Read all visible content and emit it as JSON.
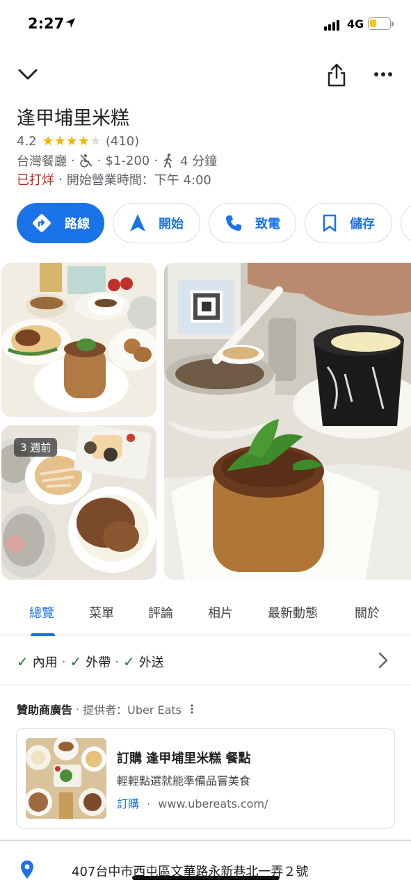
{
  "status_bar": {
    "time": "2:27",
    "network": "4G"
  },
  "place": {
    "name": "逢甲埔里米糕",
    "rating": "4.2",
    "stars_value": 4.2,
    "review_count": "(410)",
    "category": "台灣餐廳",
    "price": "$1-200",
    "walk_time": "4 分鐘",
    "status": "已打烊",
    "opens": "開始營業時間：下午 4:00",
    "address": "407台中市西屯區文華路永新巷北一弄２號"
  },
  "actions": [
    {
      "label": "路線",
      "icon": "directions-icon"
    },
    {
      "label": "開始",
      "icon": "navigation-arrow-icon"
    },
    {
      "label": "致電",
      "icon": "phone-icon"
    },
    {
      "label": "儲存",
      "icon": "bookmark-icon"
    }
  ],
  "photos": {
    "badge": "3 週前"
  },
  "tabs": [
    "總覽",
    "菜單",
    "評論",
    "相片",
    "最新動態",
    "關於"
  ],
  "active_tab": "總覽",
  "services": [
    "內用",
    "外帶",
    "外送"
  ],
  "ad": {
    "header_label": "贊助商廣告",
    "provider": "提供者：Uber Eats",
    "title": "訂購 逢甲埔里米糕 餐點",
    "description": "輕輕點選就能準備品嘗美食",
    "link_action": "訂購",
    "link_url": "www.ubereats.com/"
  },
  "colors": {
    "accent": "#1a73e8",
    "star": "#f4b400",
    "closed": "#c5221f",
    "check": "#188038"
  }
}
